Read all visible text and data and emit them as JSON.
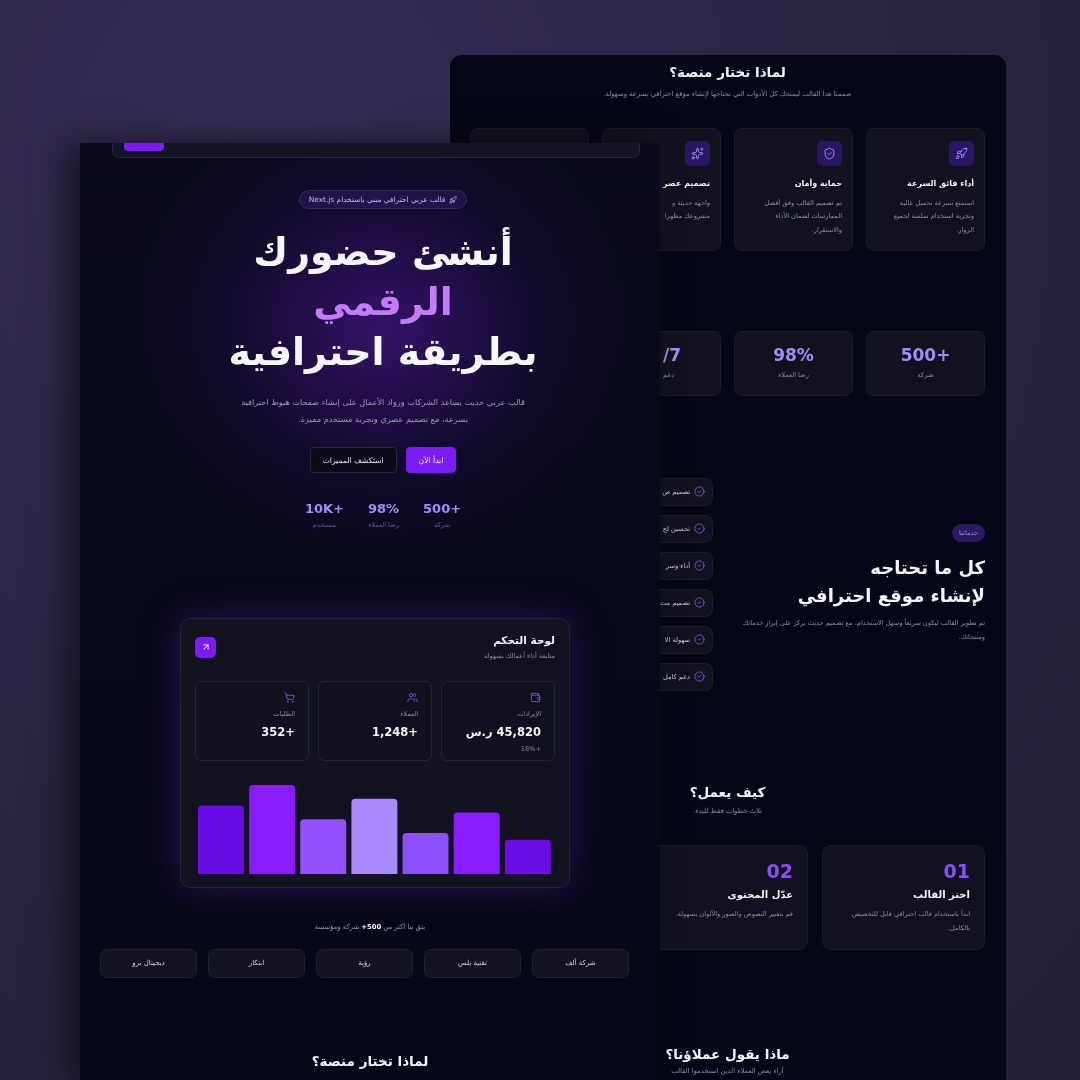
{
  "back_page": {
    "why_section": {
      "title": "لماذا تختار منصة؟",
      "subtitle": "صممنا هذا القالب ليمنحك كل الأدوات التي تحتاجها لإنشاء موقع احترافي بسرعة وسهولة.",
      "features": [
        {
          "title": "أداء فائق السرعة",
          "description_lines": [
            "استمتع بسرعة تحميل عالية",
            "وتجربة استخدام سلسة لجميع",
            "الزوار."
          ]
        },
        {
          "title": "حماية وأمان",
          "description_lines": [
            "تم تصميم القالب وفق أفضل",
            "الممارسات لضمان الأداء",
            "والاستقرار."
          ]
        },
        {
          "title": "تصميم عصر",
          "description_lines": [
            "واجهة حديثة و",
            "مشروعك مظهرا"
          ]
        }
      ]
    },
    "stats": [
      {
        "value": "500+",
        "label": "شركة"
      },
      {
        "value": "98%",
        "label": "رضا العملاء"
      },
      {
        "value": "/7",
        "label": "دعم"
      }
    ],
    "services": {
      "badge": "خدماتنا",
      "title_lines": [
        "كل ما تحتاجه",
        "لإنشاء موقع احترافي"
      ],
      "description_lines": [
        "تم تطوير القالب ليكون سريعاً وسهل الاستخدام، مع تصميم حديث يركز على إبراز خدماتك",
        "ومنتجاتك."
      ],
      "items": [
        "تصميم ص",
        "تحسين لج",
        "أداء وسر",
        "تصميم مت",
        "سهولة الا",
        "دعم كامل"
      ]
    },
    "how_it_works": {
      "title": "كيف يعمل؟",
      "subtitle": "ثلاث خطوات فقط للبدء.",
      "steps": [
        {
          "number": "01",
          "title": "اختر القالب",
          "description_lines": [
            "ابدأ باستخدام قالب احترافي قابل للتخصيص",
            "بالكامل."
          ]
        },
        {
          "number": "02",
          "title": "عدّل المحتوى",
          "description_lines": [
            "قم بتغيير النصوص والصور والألوان بسهولة."
          ]
        }
      ]
    },
    "testimonials": {
      "title": "ماذا يقول عملاؤنا؟",
      "subtitle": "آراء بعض العملاء الذين استخدموا القالب"
    }
  },
  "front_page": {
    "hero": {
      "badge": "قالب عربي احترافي مبني باستخدام Next.js",
      "title_lines": [
        {
          "text": "أنشئ حضورك",
          "highlight": false
        },
        {
          "text": "الرقمي",
          "highlight": true
        },
        {
          "text": "بطريقة احترافية",
          "highlight": false
        }
      ],
      "description_lines": [
        "قالب عربي حديث يساعد الشركات ورواد الأعمال على إنشاء صفحات هبوط احترافية",
        "بسرعة، مع تصميم عصري وتجربة مستخدم مميزة."
      ],
      "buttons": [
        {
          "label": "ابدأ الآن",
          "kind": "primary"
        },
        {
          "label": "استكشف المميزات",
          "kind": "secondary"
        }
      ],
      "stats": [
        {
          "value": "500+",
          "label": "شركة"
        },
        {
          "value": "98%",
          "label": "رضا العملاء"
        },
        {
          "value": "10K+",
          "label": "مستخدم"
        }
      ]
    },
    "dashboard": {
      "title": "لوحة التحكم",
      "subtitle": "متابعة أداء أعمالك بسهولة",
      "cards": [
        {
          "label": "الإيرادات",
          "value": "45,820 ر.س",
          "change": "+18%"
        },
        {
          "label": "العملاء",
          "value": "+1,248"
        },
        {
          "label": "الطلبات",
          "value": "+352"
        }
      ]
    },
    "trust_line": "يثق بنا أكثر من **500+** شركة ومؤسسة",
    "clients": [
      "شركة ألف",
      "تقنية بلس",
      "رؤية",
      "ابتكار",
      "ديجيتال برو"
    ],
    "next_section_title": "لماذا تختار منصة؟"
  }
}
